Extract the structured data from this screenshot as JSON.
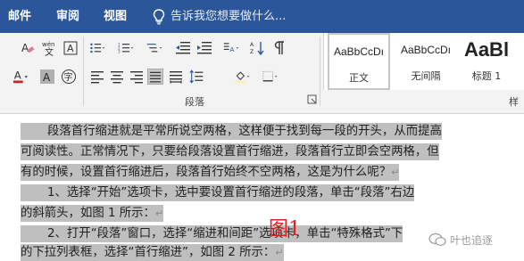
{
  "tabs": [
    "邮件",
    "审阅",
    "视图"
  ],
  "tell_me": "告诉我您想要做什么...",
  "ribbon": {
    "paragraph_group_label": "段落",
    "styles_more_label": "样",
    "font_buttons": [
      "clear-format",
      "phonetic-guide",
      "character-border",
      "font-color",
      "highlight",
      "character-shading",
      "enclosed-character"
    ],
    "styles": [
      {
        "sample": "AaBbCcDı",
        "name": "正文"
      },
      {
        "sample": "AaBbCcDı",
        "name": "无间隔"
      },
      {
        "sample": "AaBl",
        "name": "标题 1"
      }
    ]
  },
  "document": {
    "lines": [
      "段落首行缩进就是平常所说空两格，这样便于找到每一段的开头，从而提高",
      "可阅读性。正常情况下，只要给段落设置首行缩进，段落首行立即会空两格，但",
      "有的时候，设置首行缩进后，段落首行始终不空两格，这是为什么呢？",
      "1、选择“开始”选项卡，选中要设置首行缩进的段落，单击“段落”右边",
      "的斜箭头，如图 1 所示：",
      "2、打开“段落”窗口，选择“缩进和间距”选项卡，单击“特殊格式”下",
      "的下拉列表框，选择“首行缩进”，如图 2 所示："
    ],
    "paragraph_mark": "↵"
  },
  "annotation": "图1",
  "watermark": "叶也追逐",
  "colors": {
    "tab_bar": "#2b579a",
    "selection": "#bfbfbf",
    "annotation": "#e02020"
  }
}
